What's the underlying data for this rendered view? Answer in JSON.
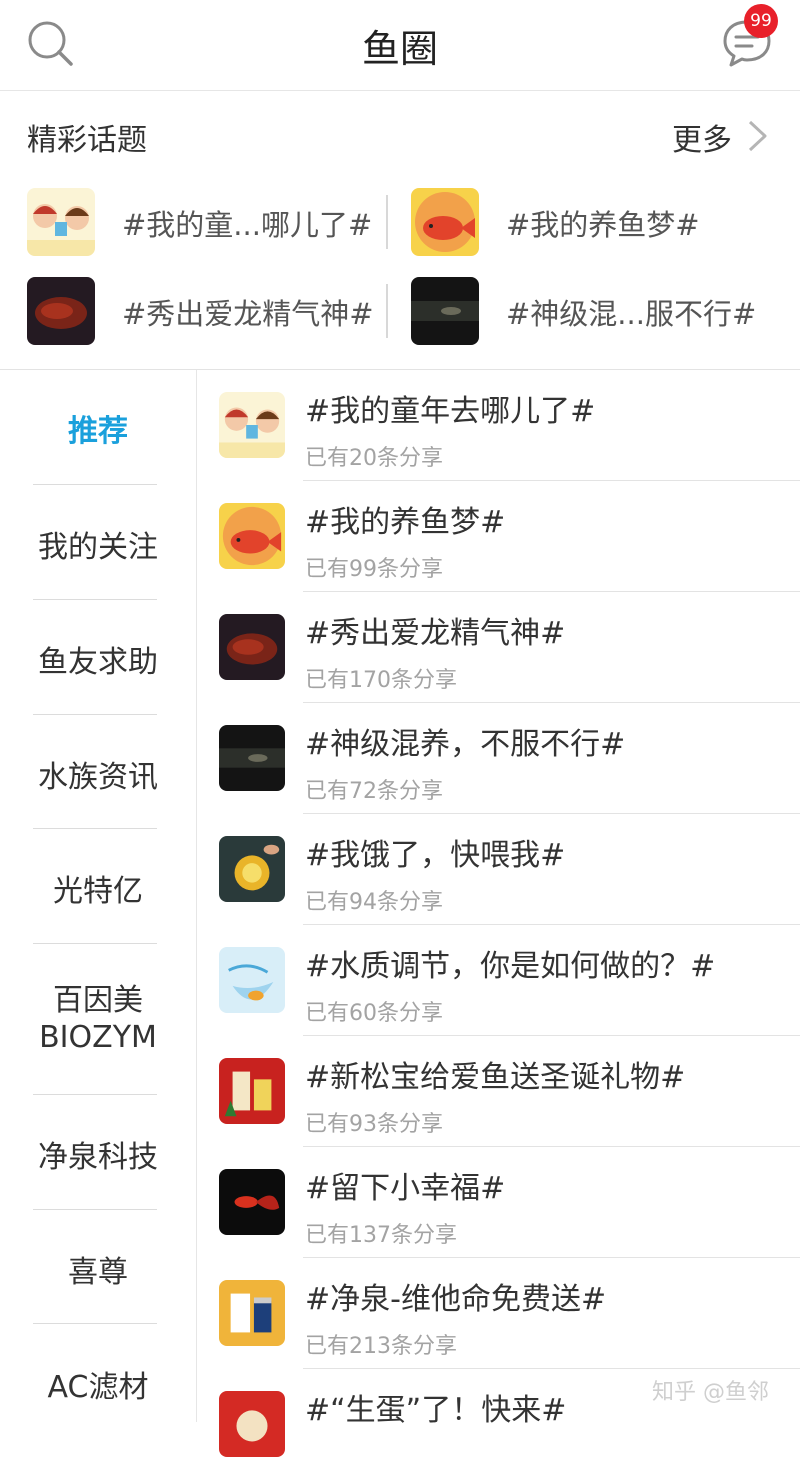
{
  "header": {
    "title": "鱼圈",
    "search_icon": "search-icon",
    "message_icon": "chat-bubble-icon",
    "message_badge": "99"
  },
  "featured": {
    "label": "精彩话题",
    "more_label": "更多",
    "more_icon": "chevron-right-icon",
    "topics": [
      {
        "text": "#我的童...哪儿了#"
      },
      {
        "text": "#我的养鱼梦#"
      },
      {
        "text": "#秀出爱龙精气神#"
      },
      {
        "text": "#神级混...服不行#"
      }
    ]
  },
  "sidebar": {
    "items": [
      {
        "label": "推荐",
        "active": true
      },
      {
        "label": "我的关注"
      },
      {
        "label": "鱼友求助"
      },
      {
        "label": "水族资讯"
      },
      {
        "label": "光特亿"
      },
      {
        "label": "百因美\nBIOZYM"
      },
      {
        "label": "净泉科技"
      },
      {
        "label": "喜尊"
      },
      {
        "label": "AC滤材"
      }
    ]
  },
  "list": [
    {
      "title": "#我的童年去哪儿了#",
      "subtitle": "已有20条分享"
    },
    {
      "title": "#我的养鱼梦#",
      "subtitle": "已有99条分享"
    },
    {
      "title": "#秀出爱龙精气神#",
      "subtitle": "已有170条分享"
    },
    {
      "title": "#神级混养，不服不行#",
      "subtitle": "已有72条分享"
    },
    {
      "title": "#我饿了，快喂我#",
      "subtitle": "已有94条分享"
    },
    {
      "title": "#水质调节，你是如何做的？#",
      "subtitle": "已有60条分享"
    },
    {
      "title": "#新松宝给爱鱼送圣诞礼物#",
      "subtitle": "已有93条分享"
    },
    {
      "title": "#留下小幸福#",
      "subtitle": "已有137条分享"
    },
    {
      "title": "#净泉-维他命免费送#",
      "subtitle": "已有213条分享"
    },
    {
      "title": "#“生蛋”了！快来#",
      "subtitle": ""
    }
  ],
  "watermark": "知乎 @鱼邻",
  "colors": {
    "accent": "#1aa0dc",
    "badge": "#e8202a",
    "divider": "#e3e3e3",
    "subtitle": "#a3a3a3"
  }
}
